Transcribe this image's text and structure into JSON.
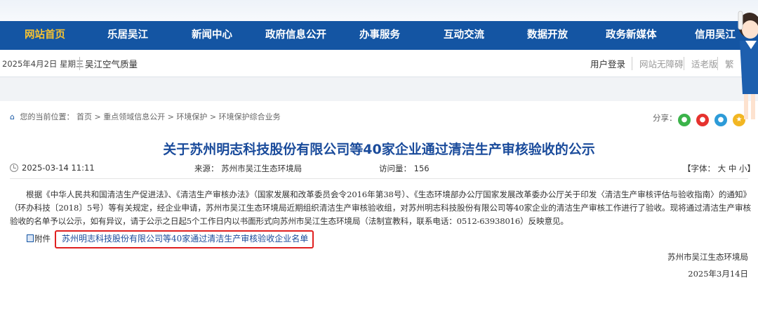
{
  "nav": {
    "items": [
      "网站首页",
      "乐居吴江",
      "新闻中心",
      "政府信息公开",
      "办事服务",
      "互动交流",
      "数据开放",
      "政务新媒体",
      "信用吴江"
    ],
    "active_index": 0
  },
  "infobar": {
    "date": "2025年4月2日 星期三",
    "air_quality": "吴江空气质量",
    "login": "用户登录",
    "tools": [
      "网站无障碍",
      "适老版",
      "繁"
    ]
  },
  "breadcrumb": {
    "prefix": "您的当前位置：",
    "path": "首页 > 重点领域信息公开 > 环境保护 > 环境保护综合业务"
  },
  "share": {
    "label": "分享："
  },
  "article": {
    "title": "关于苏州明志科技股份有限公司等40家企业通过清洁生产审核验收的公示",
    "date": "2025-03-14 11:11",
    "source": "来源：  苏州市吴江生态环境局",
    "views": "访问量：  156",
    "font_label": "【字体：",
    "font_large": "大",
    "font_medium": "中",
    "font_small": "小】",
    "body": "根据《中华人民共和国清洁生产促进法》、《清洁生产审核办法》（国家发展和改革委员会令2016年第38号）、《生态环境部办公厅国家发展改革委办公厅关于印发〈清洁生产审核评估与验收指南〉的通知》（环办科技〔2018〕5号）等有关规定，经企业申请，苏州市吴江生态环境局近期组织清洁生产审核验收组，对苏州明志科技股份有限公司等40家企业的清洁生产审核工作进行了验收。现将通过清洁生产审核验收的名单予以公示，如有异议，请于公示之日起5个工作日内以书面形式向苏州市吴江生态环境局（法制宣教科，联系电话：0512-63938016）反映意见。",
    "attachment_label": "附件",
    "attachment": "苏州明志科技股份有限公司等40家通过清洁生产审核验收企业名单",
    "signer": "苏州市吴江生态环境局",
    "sign_date": "2025年3月14日"
  },
  "colors": {
    "nav_bg": "#1455a3",
    "active_nav": "#f7c331",
    "title": "#1a4b9b",
    "highlight": "#e02020"
  }
}
